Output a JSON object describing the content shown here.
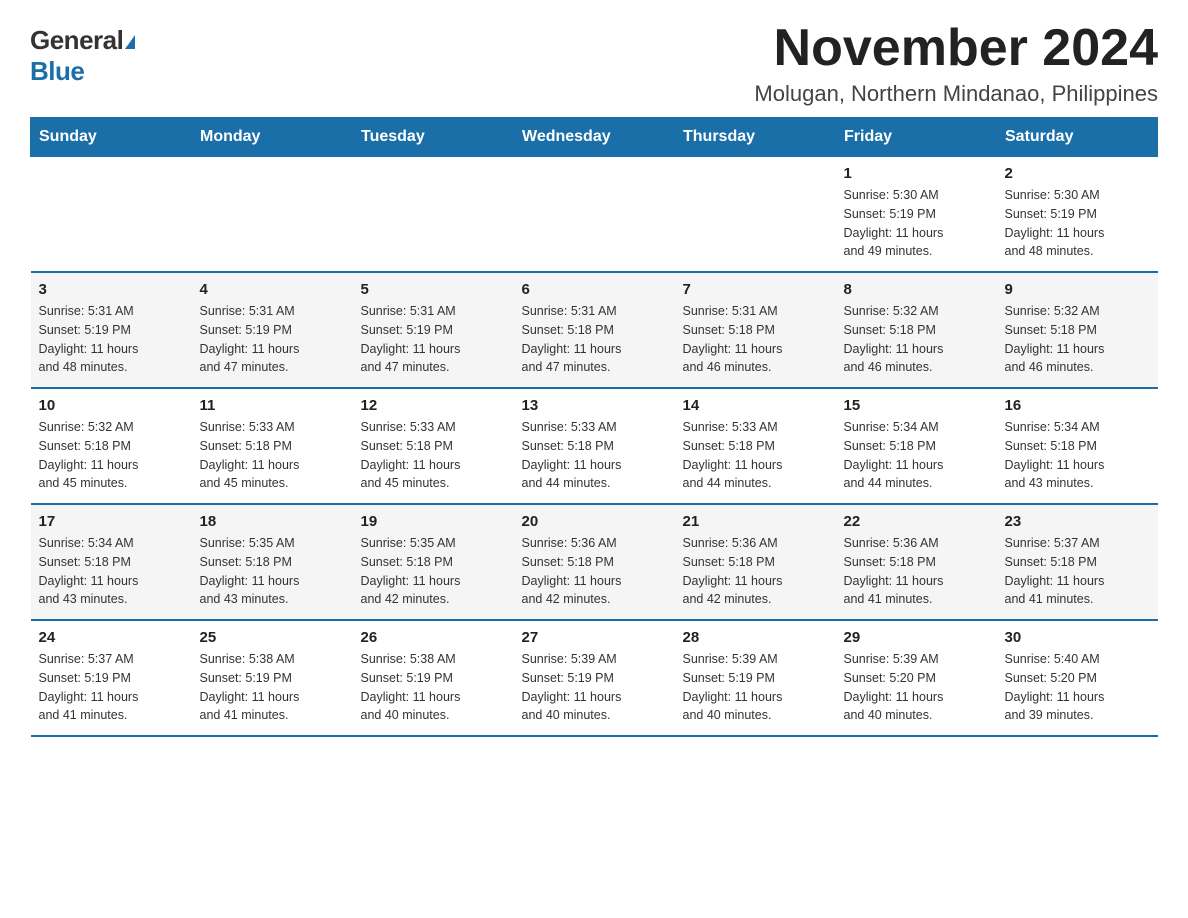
{
  "logo": {
    "general": "General",
    "blue": "Blue"
  },
  "title": {
    "main": "November 2024",
    "sub": "Molugan, Northern Mindanao, Philippines"
  },
  "days_header": [
    "Sunday",
    "Monday",
    "Tuesday",
    "Wednesday",
    "Thursday",
    "Friday",
    "Saturday"
  ],
  "weeks": [
    [
      {
        "day": "",
        "info": ""
      },
      {
        "day": "",
        "info": ""
      },
      {
        "day": "",
        "info": ""
      },
      {
        "day": "",
        "info": ""
      },
      {
        "day": "",
        "info": ""
      },
      {
        "day": "1",
        "info": "Sunrise: 5:30 AM\nSunset: 5:19 PM\nDaylight: 11 hours\nand 49 minutes."
      },
      {
        "day": "2",
        "info": "Sunrise: 5:30 AM\nSunset: 5:19 PM\nDaylight: 11 hours\nand 48 minutes."
      }
    ],
    [
      {
        "day": "3",
        "info": "Sunrise: 5:31 AM\nSunset: 5:19 PM\nDaylight: 11 hours\nand 48 minutes."
      },
      {
        "day": "4",
        "info": "Sunrise: 5:31 AM\nSunset: 5:19 PM\nDaylight: 11 hours\nand 47 minutes."
      },
      {
        "day": "5",
        "info": "Sunrise: 5:31 AM\nSunset: 5:19 PM\nDaylight: 11 hours\nand 47 minutes."
      },
      {
        "day": "6",
        "info": "Sunrise: 5:31 AM\nSunset: 5:18 PM\nDaylight: 11 hours\nand 47 minutes."
      },
      {
        "day": "7",
        "info": "Sunrise: 5:31 AM\nSunset: 5:18 PM\nDaylight: 11 hours\nand 46 minutes."
      },
      {
        "day": "8",
        "info": "Sunrise: 5:32 AM\nSunset: 5:18 PM\nDaylight: 11 hours\nand 46 minutes."
      },
      {
        "day": "9",
        "info": "Sunrise: 5:32 AM\nSunset: 5:18 PM\nDaylight: 11 hours\nand 46 minutes."
      }
    ],
    [
      {
        "day": "10",
        "info": "Sunrise: 5:32 AM\nSunset: 5:18 PM\nDaylight: 11 hours\nand 45 minutes."
      },
      {
        "day": "11",
        "info": "Sunrise: 5:33 AM\nSunset: 5:18 PM\nDaylight: 11 hours\nand 45 minutes."
      },
      {
        "day": "12",
        "info": "Sunrise: 5:33 AM\nSunset: 5:18 PM\nDaylight: 11 hours\nand 45 minutes."
      },
      {
        "day": "13",
        "info": "Sunrise: 5:33 AM\nSunset: 5:18 PM\nDaylight: 11 hours\nand 44 minutes."
      },
      {
        "day": "14",
        "info": "Sunrise: 5:33 AM\nSunset: 5:18 PM\nDaylight: 11 hours\nand 44 minutes."
      },
      {
        "day": "15",
        "info": "Sunrise: 5:34 AM\nSunset: 5:18 PM\nDaylight: 11 hours\nand 44 minutes."
      },
      {
        "day": "16",
        "info": "Sunrise: 5:34 AM\nSunset: 5:18 PM\nDaylight: 11 hours\nand 43 minutes."
      }
    ],
    [
      {
        "day": "17",
        "info": "Sunrise: 5:34 AM\nSunset: 5:18 PM\nDaylight: 11 hours\nand 43 minutes."
      },
      {
        "day": "18",
        "info": "Sunrise: 5:35 AM\nSunset: 5:18 PM\nDaylight: 11 hours\nand 43 minutes."
      },
      {
        "day": "19",
        "info": "Sunrise: 5:35 AM\nSunset: 5:18 PM\nDaylight: 11 hours\nand 42 minutes."
      },
      {
        "day": "20",
        "info": "Sunrise: 5:36 AM\nSunset: 5:18 PM\nDaylight: 11 hours\nand 42 minutes."
      },
      {
        "day": "21",
        "info": "Sunrise: 5:36 AM\nSunset: 5:18 PM\nDaylight: 11 hours\nand 42 minutes."
      },
      {
        "day": "22",
        "info": "Sunrise: 5:36 AM\nSunset: 5:18 PM\nDaylight: 11 hours\nand 41 minutes."
      },
      {
        "day": "23",
        "info": "Sunrise: 5:37 AM\nSunset: 5:18 PM\nDaylight: 11 hours\nand 41 minutes."
      }
    ],
    [
      {
        "day": "24",
        "info": "Sunrise: 5:37 AM\nSunset: 5:19 PM\nDaylight: 11 hours\nand 41 minutes."
      },
      {
        "day": "25",
        "info": "Sunrise: 5:38 AM\nSunset: 5:19 PM\nDaylight: 11 hours\nand 41 minutes."
      },
      {
        "day": "26",
        "info": "Sunrise: 5:38 AM\nSunset: 5:19 PM\nDaylight: 11 hours\nand 40 minutes."
      },
      {
        "day": "27",
        "info": "Sunrise: 5:39 AM\nSunset: 5:19 PM\nDaylight: 11 hours\nand 40 minutes."
      },
      {
        "day": "28",
        "info": "Sunrise: 5:39 AM\nSunset: 5:19 PM\nDaylight: 11 hours\nand 40 minutes."
      },
      {
        "day": "29",
        "info": "Sunrise: 5:39 AM\nSunset: 5:20 PM\nDaylight: 11 hours\nand 40 minutes."
      },
      {
        "day": "30",
        "info": "Sunrise: 5:40 AM\nSunset: 5:20 PM\nDaylight: 11 hours\nand 39 minutes."
      }
    ]
  ]
}
